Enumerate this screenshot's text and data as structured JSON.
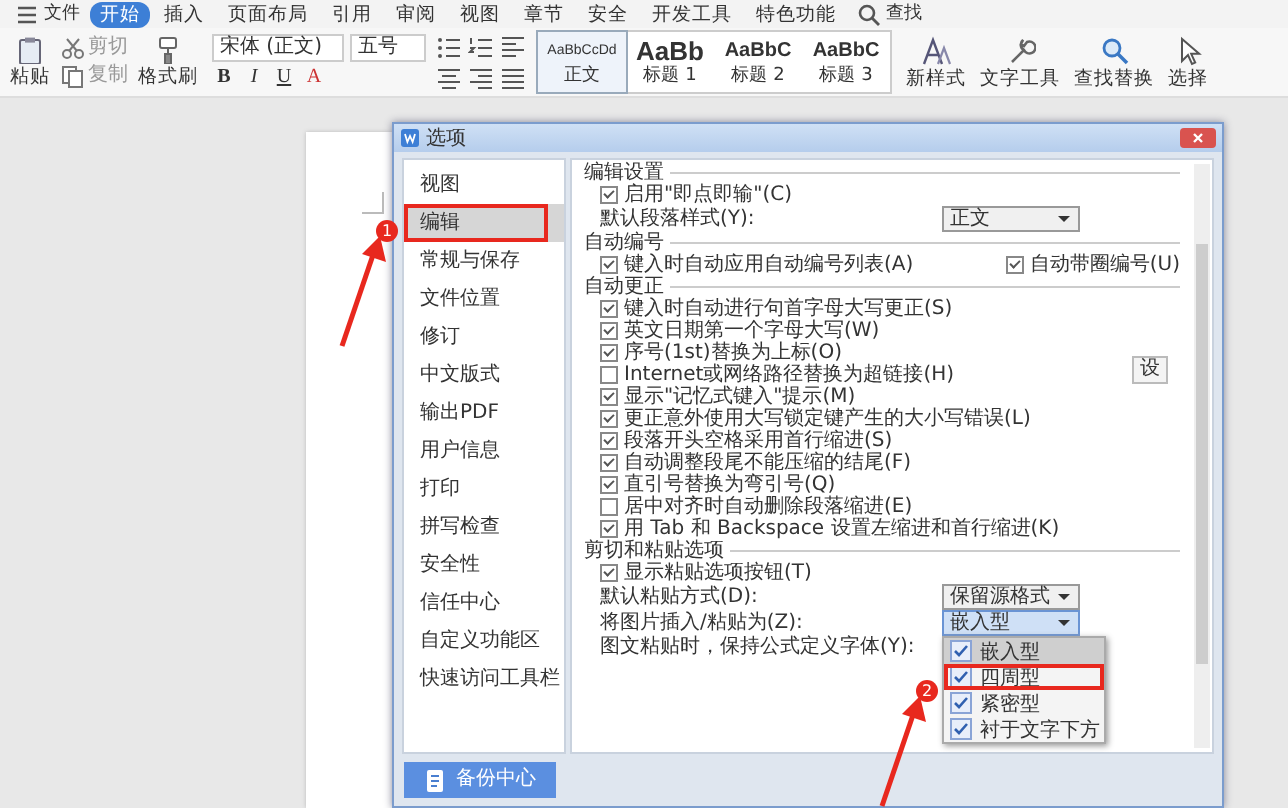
{
  "menu_bar": {
    "file": "文件",
    "tabs": [
      {
        "label": "开始",
        "selected": true
      },
      {
        "label": "插入",
        "selected": false
      },
      {
        "label": "页面布局",
        "selected": false
      },
      {
        "label": "引用",
        "selected": false
      },
      {
        "label": "审阅",
        "selected": false
      },
      {
        "label": "视图",
        "selected": false
      },
      {
        "label": "章节",
        "selected": false
      },
      {
        "label": "安全",
        "selected": false
      },
      {
        "label": "开发工具",
        "selected": false
      },
      {
        "label": "特色功能",
        "selected": false
      }
    ],
    "search": "查找"
  },
  "ribbon": {
    "clipboard": [
      {
        "kind": "paste",
        "label": "粘贴"
      },
      {
        "kind": "cut",
        "label": "剪切"
      },
      {
        "kind": "copy",
        "label": "复制"
      },
      {
        "kind": "brush",
        "label": "格式刷"
      }
    ],
    "font_name": "宋体 (正文)",
    "font_size": "五号",
    "format_buttons": [
      "B",
      "I",
      "U",
      "A"
    ],
    "styles": [
      {
        "preview": "AaBbCcDd",
        "label": "正文",
        "selected": true
      },
      {
        "preview": "AaBb",
        "label": "标题 1",
        "selected": false
      },
      {
        "preview": "AaBbC",
        "label": "标题 2",
        "selected": false
      },
      {
        "preview": "AaBbC",
        "label": "标题 3",
        "selected": false
      }
    ],
    "tools": [
      {
        "kind": "style",
        "label": "新样式"
      },
      {
        "kind": "wrench",
        "label": "文字工具"
      },
      {
        "kind": "find",
        "label": "查找替换"
      },
      {
        "kind": "pointer",
        "label": "选择"
      }
    ]
  },
  "dialog": {
    "title": "选项",
    "sidebar": {
      "items": [
        {
          "label": "视图",
          "selected": false
        },
        {
          "label": "编辑",
          "selected": true,
          "annotation": "1"
        },
        {
          "label": "常规与保存",
          "selected": false
        },
        {
          "label": "文件位置",
          "selected": false
        },
        {
          "label": "修订",
          "selected": false
        },
        {
          "label": "中文版式",
          "selected": false
        },
        {
          "label": "输出PDF",
          "selected": false
        },
        {
          "label": "用户信息",
          "selected": false
        },
        {
          "label": "打印",
          "selected": false
        },
        {
          "label": "拼写检查",
          "selected": false
        },
        {
          "label": "安全性",
          "selected": false
        },
        {
          "label": "信任中心",
          "selected": false
        },
        {
          "label": "自定义功能区",
          "selected": false
        },
        {
          "label": "快速访问工具栏",
          "selected": false
        }
      ]
    },
    "backup_button": "备份中心",
    "side_button": "设",
    "sections": [
      {
        "title": "编辑设置",
        "rows": [
          {
            "kind": "check",
            "label": "启用\"即点即输\"(C)",
            "checked": true
          },
          {
            "kind": "select",
            "label": "默认段落样式(Y):",
            "value": "正文"
          }
        ]
      },
      {
        "title": "自动编号",
        "rows": [
          {
            "kind": "checks",
            "items": [
              {
                "label": "键入时自动应用自动编号列表(A)",
                "checked": true
              },
              {
                "label": "自动带圈编号(U)",
                "checked": true
              }
            ]
          }
        ]
      },
      {
        "title": "自动更正",
        "rows": [
          {
            "kind": "check",
            "label": "键入时自动进行句首字母大写更正(S)",
            "checked": true
          },
          {
            "kind": "check",
            "label": "英文日期第一个字母大写(W)",
            "checked": true
          },
          {
            "kind": "check",
            "label": "序号(1st)替换为上标(O)",
            "checked": true
          },
          {
            "kind": "check",
            "label": "Internet或网络路径替换为超链接(H)",
            "checked": false
          },
          {
            "kind": "check",
            "label": "显示\"记忆式键入\"提示(M)",
            "checked": true
          },
          {
            "kind": "check",
            "label": "更正意外使用大写锁定键产生的大小写错误(L)",
            "checked": true
          },
          {
            "kind": "check",
            "label": "段落开头空格采用首行缩进(S)",
            "checked": true
          },
          {
            "kind": "check",
            "label": "自动调整段尾不能压缩的结尾(F)",
            "checked": true
          },
          {
            "kind": "check",
            "label": "直引号替换为弯引号(Q)",
            "checked": true
          },
          {
            "kind": "check",
            "label": "居中对齐时自动删除段落缩进(E)",
            "checked": false
          },
          {
            "kind": "check",
            "label": "用 Tab 和 Backspace 设置左缩进和首行缩进(K)",
            "checked": true
          }
        ]
      },
      {
        "title": "剪切和粘贴选项",
        "rows": [
          {
            "kind": "check",
            "label": "显示粘贴选项按钮(T)",
            "checked": true
          },
          {
            "kind": "select",
            "label": "默认粘贴方式(D):",
            "value": "保留源格式"
          },
          {
            "kind": "select",
            "label": "将图片插入/粘贴为(Z):",
            "value": "嵌入型",
            "expanded": true,
            "options": [
              {
                "label": "嵌入型",
                "selected": true
              },
              {
                "label": "四周型",
                "selected": false,
                "annotation": "2"
              },
              {
                "label": "紧密型",
                "selected": false
              },
              {
                "label": "衬于文字下方",
                "selected": false
              }
            ]
          },
          {
            "kind": "label",
            "label": "图文粘贴时，保持公式定义字体(Y):"
          }
        ]
      }
    ]
  }
}
